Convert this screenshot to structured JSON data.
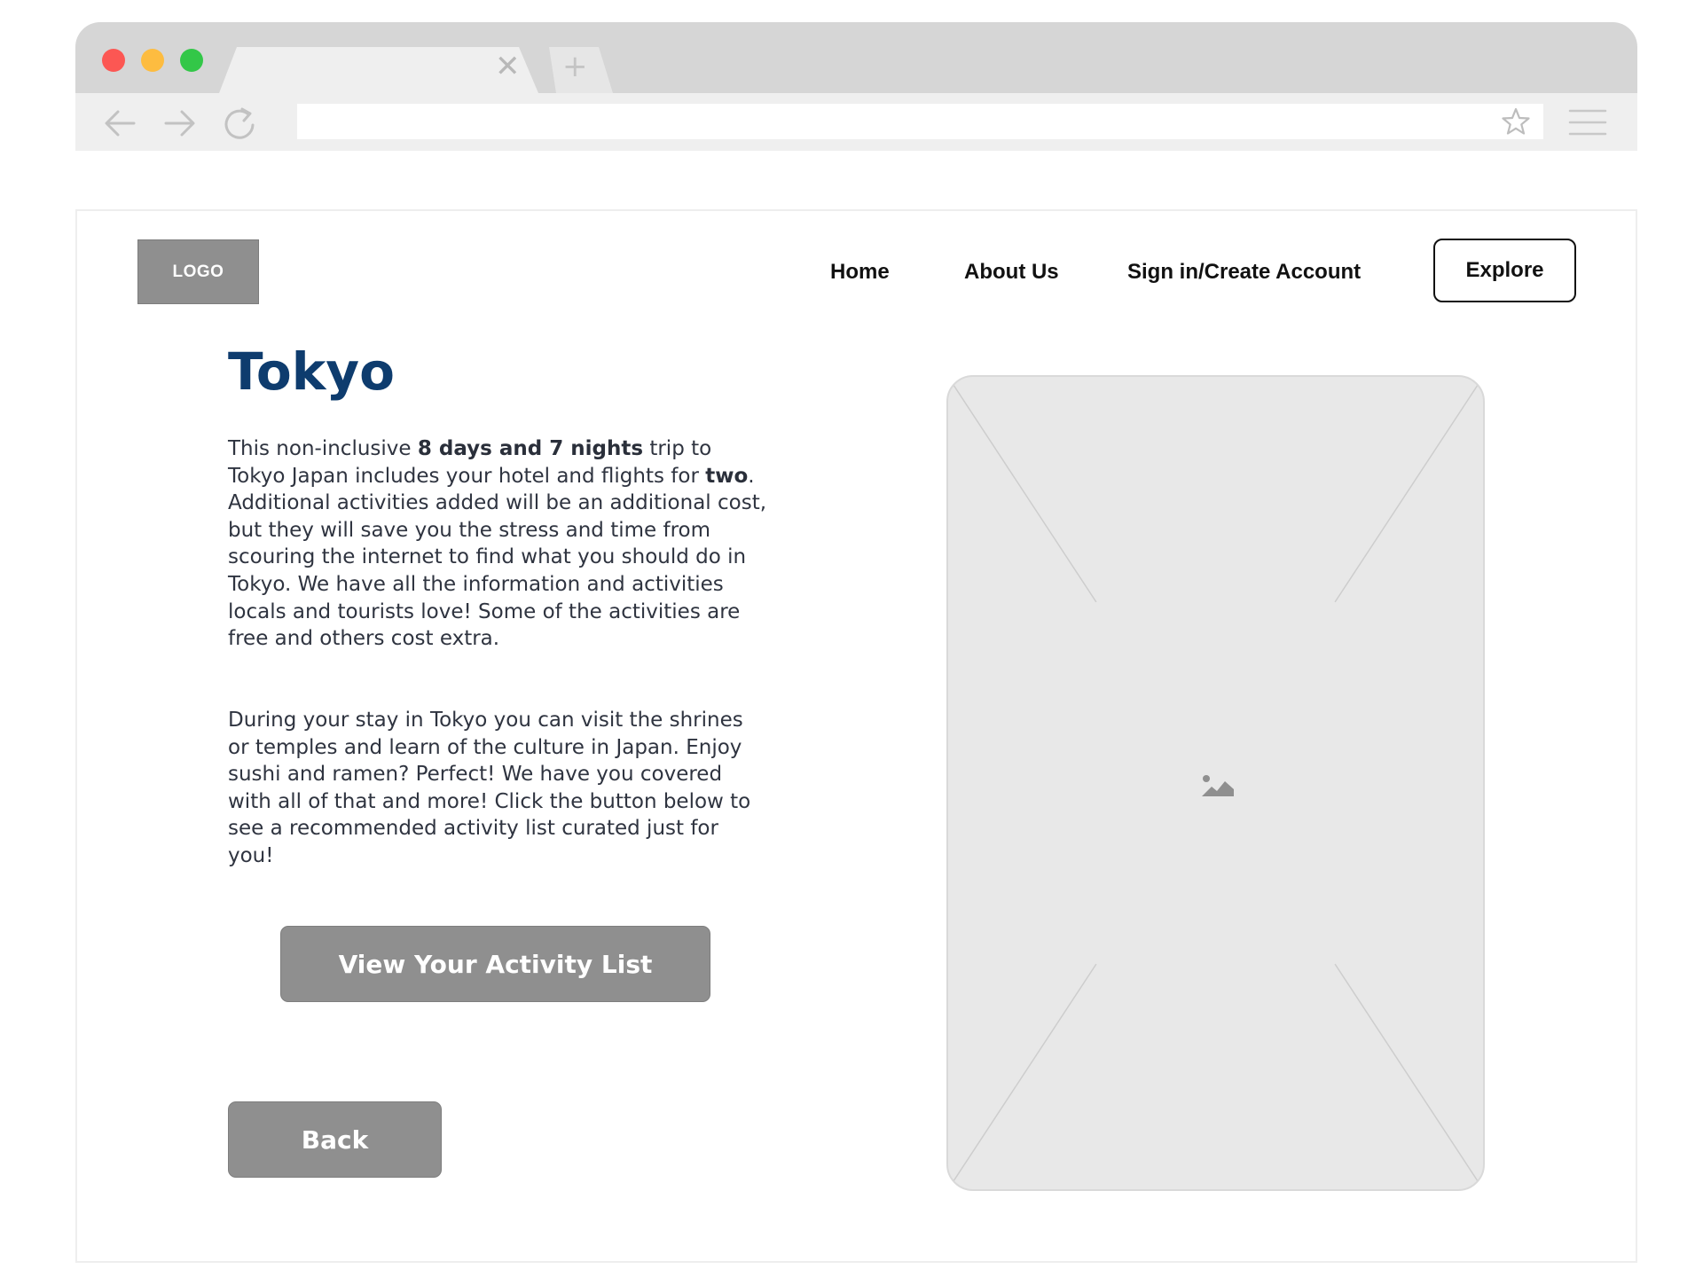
{
  "browser": {
    "tab_close_glyph": "✕",
    "new_tab_glyph": "+",
    "address_value": ""
  },
  "header": {
    "logo": "LOGO",
    "nav": {
      "home": "Home",
      "about": "About Us",
      "sign_in": "Sign in/Create Account"
    },
    "explore_button": "Explore"
  },
  "main": {
    "title": "Tokyo",
    "paragraph1": {
      "part1": "This non-inclusive ",
      "bold1": "8 days and 7 nights",
      "part2": " trip to Tokyo Japan includes your hotel and flights for ",
      "bold2": "two",
      "part3": ". Additional activities added will be an additional cost, but they will save you the stress and time from scouring the internet to find what you should do in Tokyo. We have all the information and activities locals and tourists love! Some of the activities are free and others cost extra."
    },
    "paragraph2": "During your stay in Tokyo you can visit the shrines or temples and learn of the culture in Japan. Enjoy sushi and ramen? Perfect! We have you covered with all of that and more! Click the button below to see a recommended activity list curated just for you!",
    "activity_button": "View Your Activity List",
    "back_button": "Back"
  },
  "icons": {
    "back": "arrow-left-icon",
    "forward": "arrow-right-icon",
    "reload": "reload-icon",
    "bookmark": "star-icon",
    "menu": "hamburger-menu-icon",
    "image": "image-placeholder-icon"
  },
  "colors": {
    "title": "#0e3c6e",
    "button_grey": "#8f8f8f",
    "traffic_red": "#fc5753",
    "traffic_yellow": "#fdbc40",
    "traffic_green": "#33c748"
  }
}
